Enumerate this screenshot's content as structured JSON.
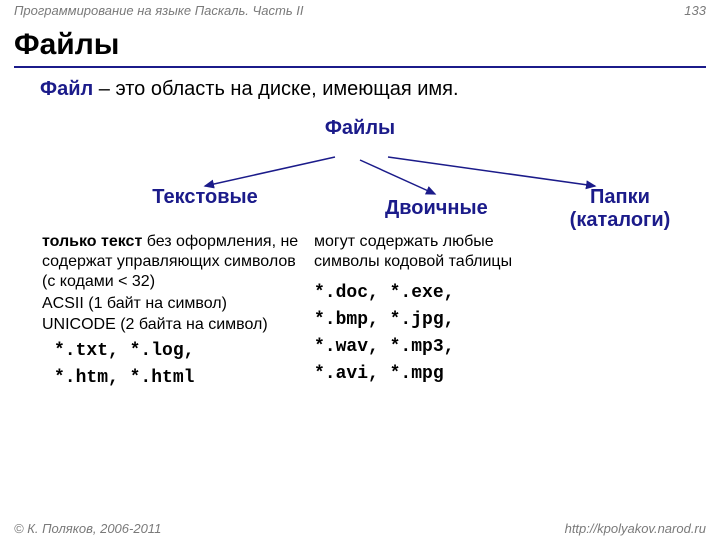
{
  "header": {
    "course": "Программирование на языке Паскаль. Часть II",
    "page": "133"
  },
  "title": "Файлы",
  "definition": {
    "term": "Файл",
    "rest": " – это область на диске, имеющая имя."
  },
  "tree": {
    "root": "Файлы",
    "branch1": "Текстовые",
    "branch2": "Двоичные",
    "branch3_line1": "Папки",
    "branch3_line2": "(каталоги)"
  },
  "text_block": {
    "bold": "только текст",
    "rest": " без оформления, не содержат управляющих символов (с кодами < 32)",
    "enc1": "ACSII (1 байт на символ)",
    "enc2": "UNICODE (2 байта на символ)",
    "ext1": "*.txt, *.log,",
    "ext2": "*.htm, *.html"
  },
  "binary_block": {
    "desc": "могут содержать любые символы кодовой таблицы",
    "ext1": "*.doc, *.exe,",
    "ext2": "*.bmp, *.jpg,",
    "ext3": "*.wav, *.mp3,",
    "ext4": "*.avi, *.mpg"
  },
  "footer": {
    "copyright": "© К. Поляков, 2006-2011",
    "url": "http://kpolyakov.narod.ru"
  }
}
